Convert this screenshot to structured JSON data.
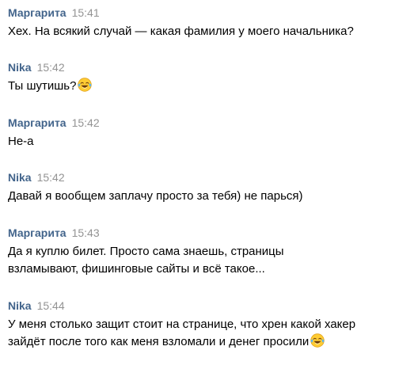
{
  "messages": [
    {
      "author": "Маргарита",
      "time": "15:41",
      "lines": [
        "Хех. На всякий случай — какая фамилия у моего начальника?"
      ],
      "emoji": ""
    },
    {
      "author": "Nika",
      "time": "15:42",
      "lines": [
        "Ты шутишь?"
      ],
      "emoji": "face-with-tears-of-joy-icon"
    },
    {
      "author": "Маргарита",
      "time": "15:42",
      "lines": [
        "Не-а"
      ],
      "emoji": ""
    },
    {
      "author": "Nika",
      "time": "15:42",
      "lines": [
        "Давай я вообщем заплачу просто за тебя) не парься)"
      ],
      "emoji": ""
    },
    {
      "author": "Маргарита",
      "time": "15:43",
      "lines": [
        "Да я куплю билет. Просто сама знаешь, страницы",
        "взламывают, фишинговые сайты и всё такое..."
      ],
      "emoji": ""
    },
    {
      "author": "Nika",
      "time": "15:44",
      "lines": [
        "У меня столько защит стоит на странице, что хрен какой хакер",
        "зайдёт после того как меня взломали и денег просили"
      ],
      "emoji": "face-with-tears-of-joy-icon"
    }
  ],
  "colors": {
    "author": "#42648b",
    "time": "#939393",
    "text": "#000000",
    "background": "#ffffff"
  }
}
